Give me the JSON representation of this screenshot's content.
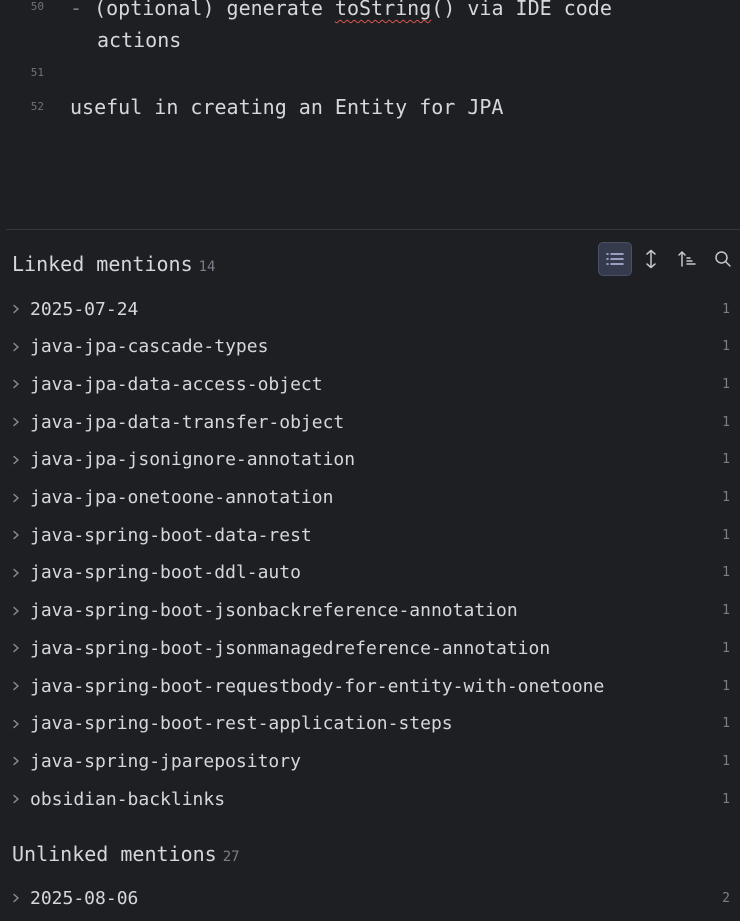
{
  "editor": {
    "lines": [
      {
        "num": "50",
        "dash": "-",
        "pre": "(optional) generate ",
        "misspelled": "toString",
        "post": "() via IDE code"
      },
      {
        "continuation": "actions"
      },
      {
        "num": "51",
        "text": ""
      },
      {
        "num": "52",
        "text": "useful in creating an Entity for JPA"
      }
    ]
  },
  "linked_mentions": {
    "title": "Linked mentions",
    "count": "14",
    "items": [
      {
        "label": "2025-07-24",
        "count": "1"
      },
      {
        "label": "java-jpa-cascade-types",
        "count": "1"
      },
      {
        "label": "java-jpa-data-access-object",
        "count": "1"
      },
      {
        "label": "java-jpa-data-transfer-object",
        "count": "1"
      },
      {
        "label": "java-jpa-jsonignore-annotation",
        "count": "1"
      },
      {
        "label": "java-jpa-onetoone-annotation",
        "count": "1"
      },
      {
        "label": "java-spring-boot-data-rest",
        "count": "1"
      },
      {
        "label": "java-spring-boot-ddl-auto",
        "count": "1"
      },
      {
        "label": "java-spring-boot-jsonbackreference-annotation",
        "count": "1"
      },
      {
        "label": "java-spring-boot-jsonmanagedreference-annotation",
        "count": "1"
      },
      {
        "label": "java-spring-boot-requestbody-for-entity-with-onetoone",
        "count": "1"
      },
      {
        "label": "java-spring-boot-rest-application-steps",
        "count": "1"
      },
      {
        "label": "java-spring-jparepository",
        "count": "1"
      },
      {
        "label": "obsidian-backlinks",
        "count": "1"
      }
    ]
  },
  "unlinked_mentions": {
    "title": "Unlinked mentions",
    "count": "27",
    "items": [
      {
        "label": "2025-08-06",
        "count": "2"
      }
    ]
  },
  "toolbar": {
    "icons": [
      "list-icon",
      "expand-icon",
      "sort-icon",
      "search-icon"
    ]
  },
  "colors": {
    "background": "#1e1f23",
    "text": "#d6d7db",
    "muted": "#7c7f88",
    "active_button": "#363a4d",
    "spellcheck": "#d9534f"
  }
}
